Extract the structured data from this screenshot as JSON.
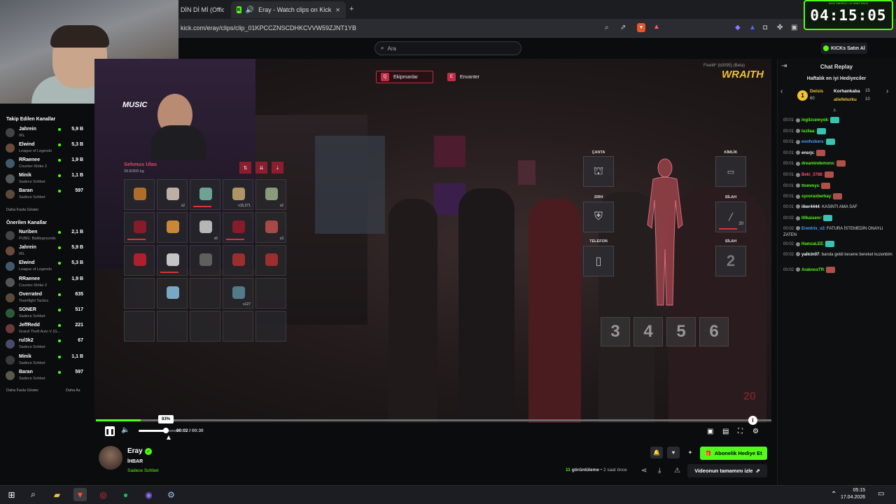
{
  "browser": {
    "tab1_title": "DİN Dİ Mİ (Official",
    "tab2_title": "Eray - Watch clips on Kick",
    "url": "kick.com/eray/clips/clip_01KPCCZNSCDHKCVVW59ZJNT1YB",
    "new_tab": "+",
    "close_tab": "✕"
  },
  "overlay_clock": {
    "subtitle": "KICK TAKİPÇİ • 12 SAAT EKLE",
    "time": "04:15:05"
  },
  "kick_header": {
    "search_placeholder": "Ara",
    "buy_kicks": "KICKs Satın Al"
  },
  "sidebar": {
    "followed_title": "Takip Edilen Kanallar",
    "followed": [
      {
        "name": "Jahrein",
        "category": "IRL",
        "viewers": "5,9 B"
      },
      {
        "name": "Elwind",
        "category": "League of Legends",
        "viewers": "5,3 B"
      },
      {
        "name": "RRaenee",
        "category": "Counter-Strike 2",
        "viewers": "1,9 B"
      },
      {
        "name": "Minik",
        "category": "Sadece Sohbet",
        "viewers": "1,1 B"
      },
      {
        "name": "Baran",
        "category": "Sadece Sohbet",
        "viewers": "597"
      }
    ],
    "show_more_1": "Daha Fazla Göster",
    "recommended_title": "Önerilen Kanallar",
    "recommended": [
      {
        "name": "Nuriben",
        "category": "PUBG: Battlegrounds",
        "viewers": "2,1 B"
      },
      {
        "name": "Jahrein",
        "category": "IRL",
        "viewers": "5,9 B"
      },
      {
        "name": "Elwind",
        "category": "League of Legends",
        "viewers": "5,3 B"
      },
      {
        "name": "RRaenee",
        "category": "Counter-Strike 2",
        "viewers": "1,9 B"
      },
      {
        "name": "Overrated",
        "category": "Teamfight Tactics",
        "viewers": "635"
      },
      {
        "name": "SONER",
        "category": "Sadece Sohbet",
        "viewers": "517"
      },
      {
        "name": "JeffRedd",
        "category": "Grand Theft Auto V (G...",
        "viewers": "221"
      },
      {
        "name": "rul3k2",
        "category": "Sadece Sohbet",
        "viewers": "67"
      },
      {
        "name": "Minik",
        "category": "Sadece Sohbet",
        "viewers": "1,1 B"
      },
      {
        "name": "Baran",
        "category": "Sadece Sohbet",
        "viewers": "597"
      }
    ],
    "show_more_2": "Daha Fazla Göster",
    "show_less": "Daha Az"
  },
  "game": {
    "tab_equip_key": "Q",
    "tab_equip": "Ekipmanlar",
    "tab_inventory_key": "E",
    "tab_inventory": "Envanter",
    "server_info": "FiveM* (b3095) (Beta)",
    "server_logo": "WRAITH",
    "stream_banner": "MUSIC",
    "player_name": "Sehmus Ulas",
    "weight": "39.8/300 kg",
    "slot_counts": [
      "",
      "x2",
      "",
      "x15,271",
      "x2",
      "",
      "",
      "x5",
      "",
      "x3",
      "",
      "",
      "",
      "",
      "",
      "",
      "",
      "",
      "x127",
      "",
      "",
      "",
      "",
      "",
      ""
    ],
    "equip_labels": {
      "bag": "ÇANTA",
      "armor": "ZIRH",
      "phone": "TELEFON",
      "id": "KİMLİK",
      "weapon1": "SİLAH",
      "weapon2": "SİLAH"
    },
    "weapon1_ammo": "20",
    "weapon2_slot": "2",
    "hotkeys": [
      "3",
      "4",
      "5",
      "6"
    ],
    "corner_number": "20"
  },
  "player": {
    "volume_tooltip": "83%",
    "volume": 0.83,
    "time_current": "00:02",
    "time_total": "00:30",
    "progress": 0.066
  },
  "channel": {
    "name": "Eray",
    "clip_title": "İHBAR",
    "category": "Sadece Sohbet",
    "subscribe_gift": "Abonelik Hediye Et",
    "views_count": "11",
    "views_label": "görüntüleme",
    "time_ago": "2 saat önce",
    "watch_full": "Videonun tamamını izle"
  },
  "chat": {
    "title": "Chat Replay",
    "gifters_title": "Haftalık en iyi Hediyeciler",
    "gifters": [
      {
        "rank": "1",
        "name": "Deisis",
        "count": "60"
      },
      {
        "name": "Korhankaba",
        "count": "15"
      },
      {
        "name": "aliefeturku",
        "count": "10"
      }
    ],
    "messages": [
      {
        "time": "00:01",
        "user": "ingilzcemyok",
        "text": "",
        "color": "#53fc18"
      },
      {
        "time": "00:01",
        "user": "luzilaa",
        "text": "",
        "color": "#53fc18"
      },
      {
        "time": "00:01",
        "user": "evofvckers",
        "text": "",
        "color": "#4aa3ff"
      },
      {
        "time": "00:01",
        "user": "ensrjc",
        "text": "",
        "color": "#ffffff"
      },
      {
        "time": "00:01",
        "user": "dreamindemonx",
        "text": "",
        "color": "#53fc18"
      },
      {
        "time": "00:01",
        "user": "Beki_3788",
        "text": "",
        "color": "#ff4d6d"
      },
      {
        "time": "00:01",
        "user": "ttommys",
        "text": "",
        "color": "#53fc18"
      },
      {
        "time": "00:01",
        "user": "sycoraxberkay",
        "text": "",
        "color": "#53fc18"
      },
      {
        "time": "00:01",
        "user": "iiker4444",
        "text": "KASINTI AMA SAF",
        "color": "#ffffff"
      },
      {
        "time": "00:02",
        "user": "00kaisenr",
        "text": "",
        "color": "#53fc18"
      },
      {
        "time": "00:02",
        "user": "Erentrix_v2",
        "text": "FATURA İSTEMEDİN ONAYLI ZATEN",
        "color": "#4aa3ff"
      },
      {
        "time": "00:02",
        "user": "HamzaLEE",
        "text": "",
        "color": "#53fc18"
      },
      {
        "time": "00:02",
        "user": "yallcin07",
        "text": "banda geldi kesene bereket kuzenbim",
        "color": "#ffffff"
      },
      {
        "time": "00:02",
        "user": "AraknosTR",
        "text": "",
        "color": "#53fc18"
      }
    ]
  },
  "taskbar": {
    "time": "05:15",
    "date": "17.04.2026"
  }
}
